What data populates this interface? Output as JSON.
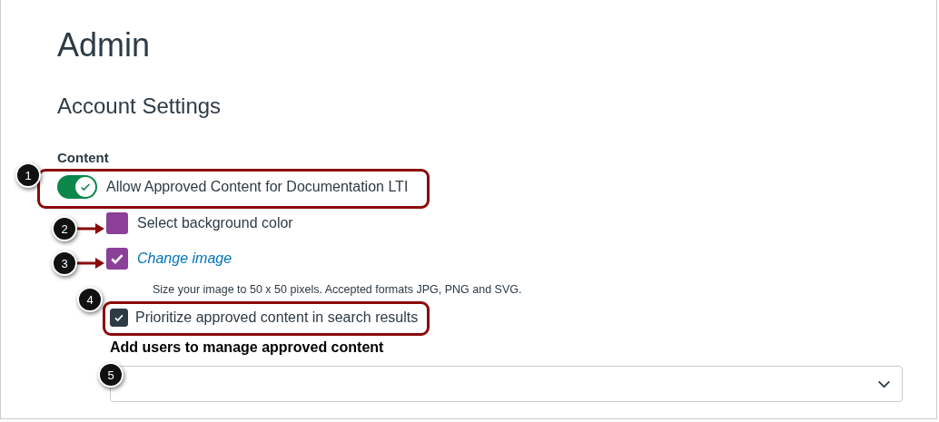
{
  "page": {
    "title": "Admin",
    "subtitle": "Account Settings"
  },
  "content": {
    "heading": "Content",
    "items": [
      {
        "kind": "toggle",
        "label": "Allow Approved Content for Documentation LTI",
        "on": true
      },
      {
        "kind": "swatch",
        "label": "Select background color",
        "color": "#8b3f98"
      },
      {
        "kind": "image-checkbox",
        "label": "Change image",
        "checked": true,
        "hint": "Size your image to 50 x 50 pixels. Accepted formats JPG, PNG and SVG."
      },
      {
        "kind": "checkbox",
        "label": "Prioritize approved content in search results",
        "checked": true
      }
    ],
    "users_label": "Add users to manage approved content"
  },
  "callouts": [
    "1",
    "2",
    "3",
    "4",
    "5"
  ]
}
